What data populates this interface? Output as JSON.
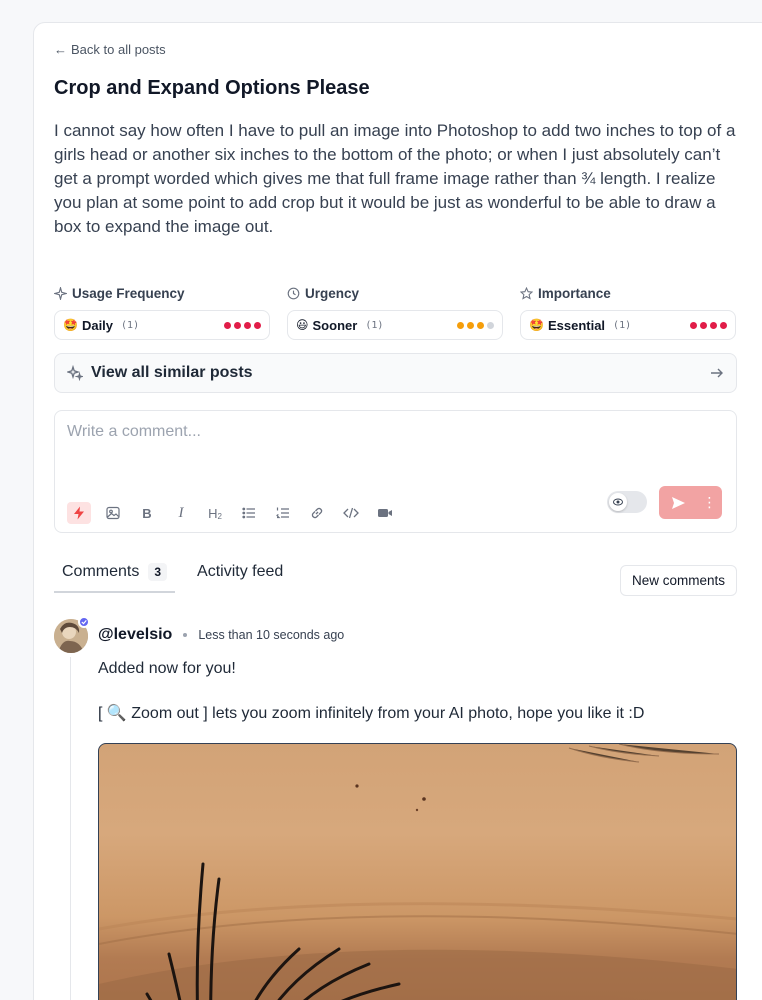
{
  "post": {
    "back_label": "Back to all posts",
    "title": "Crop and Expand Options Please",
    "body": "I cannot say how often I have to pull an image into Photoshop to add two inches to top of a girls head or another six inches to the bottom of the photo; or when I just absolutely can’t get a prompt worded which gives me that full frame image rather than ¾ length. I realize you plan at some point to add crop but it would be just as wonderful to be able to draw a box to expand the image out."
  },
  "metrics": [
    {
      "label": "Usage Frequency",
      "icon": "sparkle-icon",
      "value": "Daily",
      "emoji": "🤩",
      "count": "(1)",
      "level": 4,
      "max": 4,
      "color": "#e11d48"
    },
    {
      "label": "Urgency",
      "icon": "clock-icon",
      "value": "Sooner",
      "emoji": "😃",
      "count": "(1)",
      "level": 3,
      "max": 4,
      "color": "#f59e0b"
    },
    {
      "label": "Importance",
      "icon": "star-icon",
      "value": "Essential",
      "emoji": "🤩",
      "count": "(1)",
      "level": 4,
      "max": 4,
      "color": "#e11d48"
    }
  ],
  "similar": {
    "label": "View all similar posts"
  },
  "composer": {
    "placeholder": "Write a comment...",
    "tools": [
      "flash-icon",
      "image-icon",
      "bold-icon",
      "italic-icon",
      "heading-icon",
      "bullet-list-icon",
      "numbered-list-icon",
      "link-icon",
      "code-icon",
      "video-icon"
    ]
  },
  "tabs": {
    "comments_label": "Comments",
    "comments_count": "3",
    "activity_label": "Activity feed",
    "new_comments_label": "New comments"
  },
  "comment": {
    "username": "@levelsio",
    "timestamp": "Less than 10 seconds ago",
    "line1": "Added now for you!",
    "line2": "[ 🔍 Zoom out ] lets you zoom infinitely from your AI photo, hope you like it :D"
  },
  "colors": {
    "accent_red": "#ef4444",
    "send_button": "#f2a3a3",
    "verified": "#6366f1"
  }
}
